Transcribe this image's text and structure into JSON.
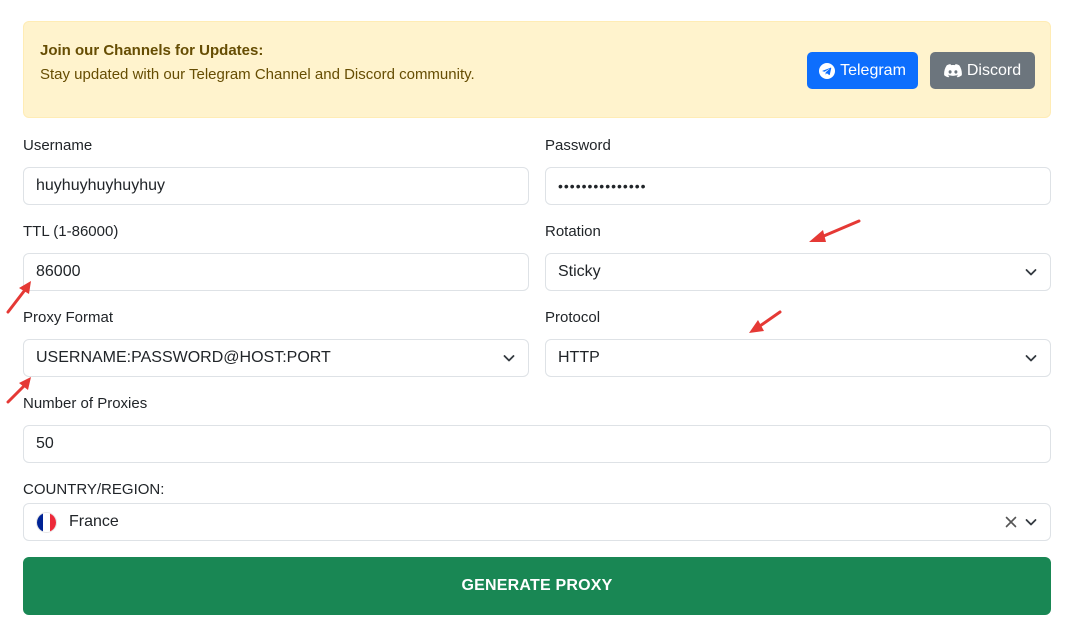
{
  "banner": {
    "title": "Join our Channels for Updates:",
    "text": "Stay updated with our Telegram Channel and Discord community.",
    "telegram_label": "Telegram",
    "discord_label": "Discord"
  },
  "form": {
    "username": {
      "label": "Username",
      "value": "huyhuyhuyhuyhuy"
    },
    "password": {
      "label": "Password",
      "value": "•••••••••••••••"
    },
    "ttl": {
      "label": "TTL (1-86000)",
      "value": "86000"
    },
    "rotation": {
      "label": "Rotation",
      "value": "Sticky"
    },
    "proxy_format": {
      "label": "Proxy Format",
      "value": "USERNAME:PASSWORD@HOST:PORT"
    },
    "protocol": {
      "label": "Protocol",
      "value": "HTTP"
    },
    "number_of_proxies": {
      "label": "Number of Proxies",
      "value": "50"
    },
    "country": {
      "label": "COUNTRY/REGION:",
      "value": "France",
      "flag_colors": [
        "#002395",
        "#ffffff",
        "#ed2939"
      ]
    }
  },
  "generate_label": "GENERATE PROXY",
  "colors": {
    "banner_bg": "#fff3cd",
    "telegram": "#0d6efd",
    "discord": "#6c757d",
    "generate": "#198754",
    "annotation_arrow": "#e53935"
  },
  "icons": {
    "telegram": "telegram-icon",
    "discord": "discord-icon",
    "chevron": "chevron-down-icon",
    "clear": "close-icon",
    "annotation": "arrow-annotation-icon"
  }
}
